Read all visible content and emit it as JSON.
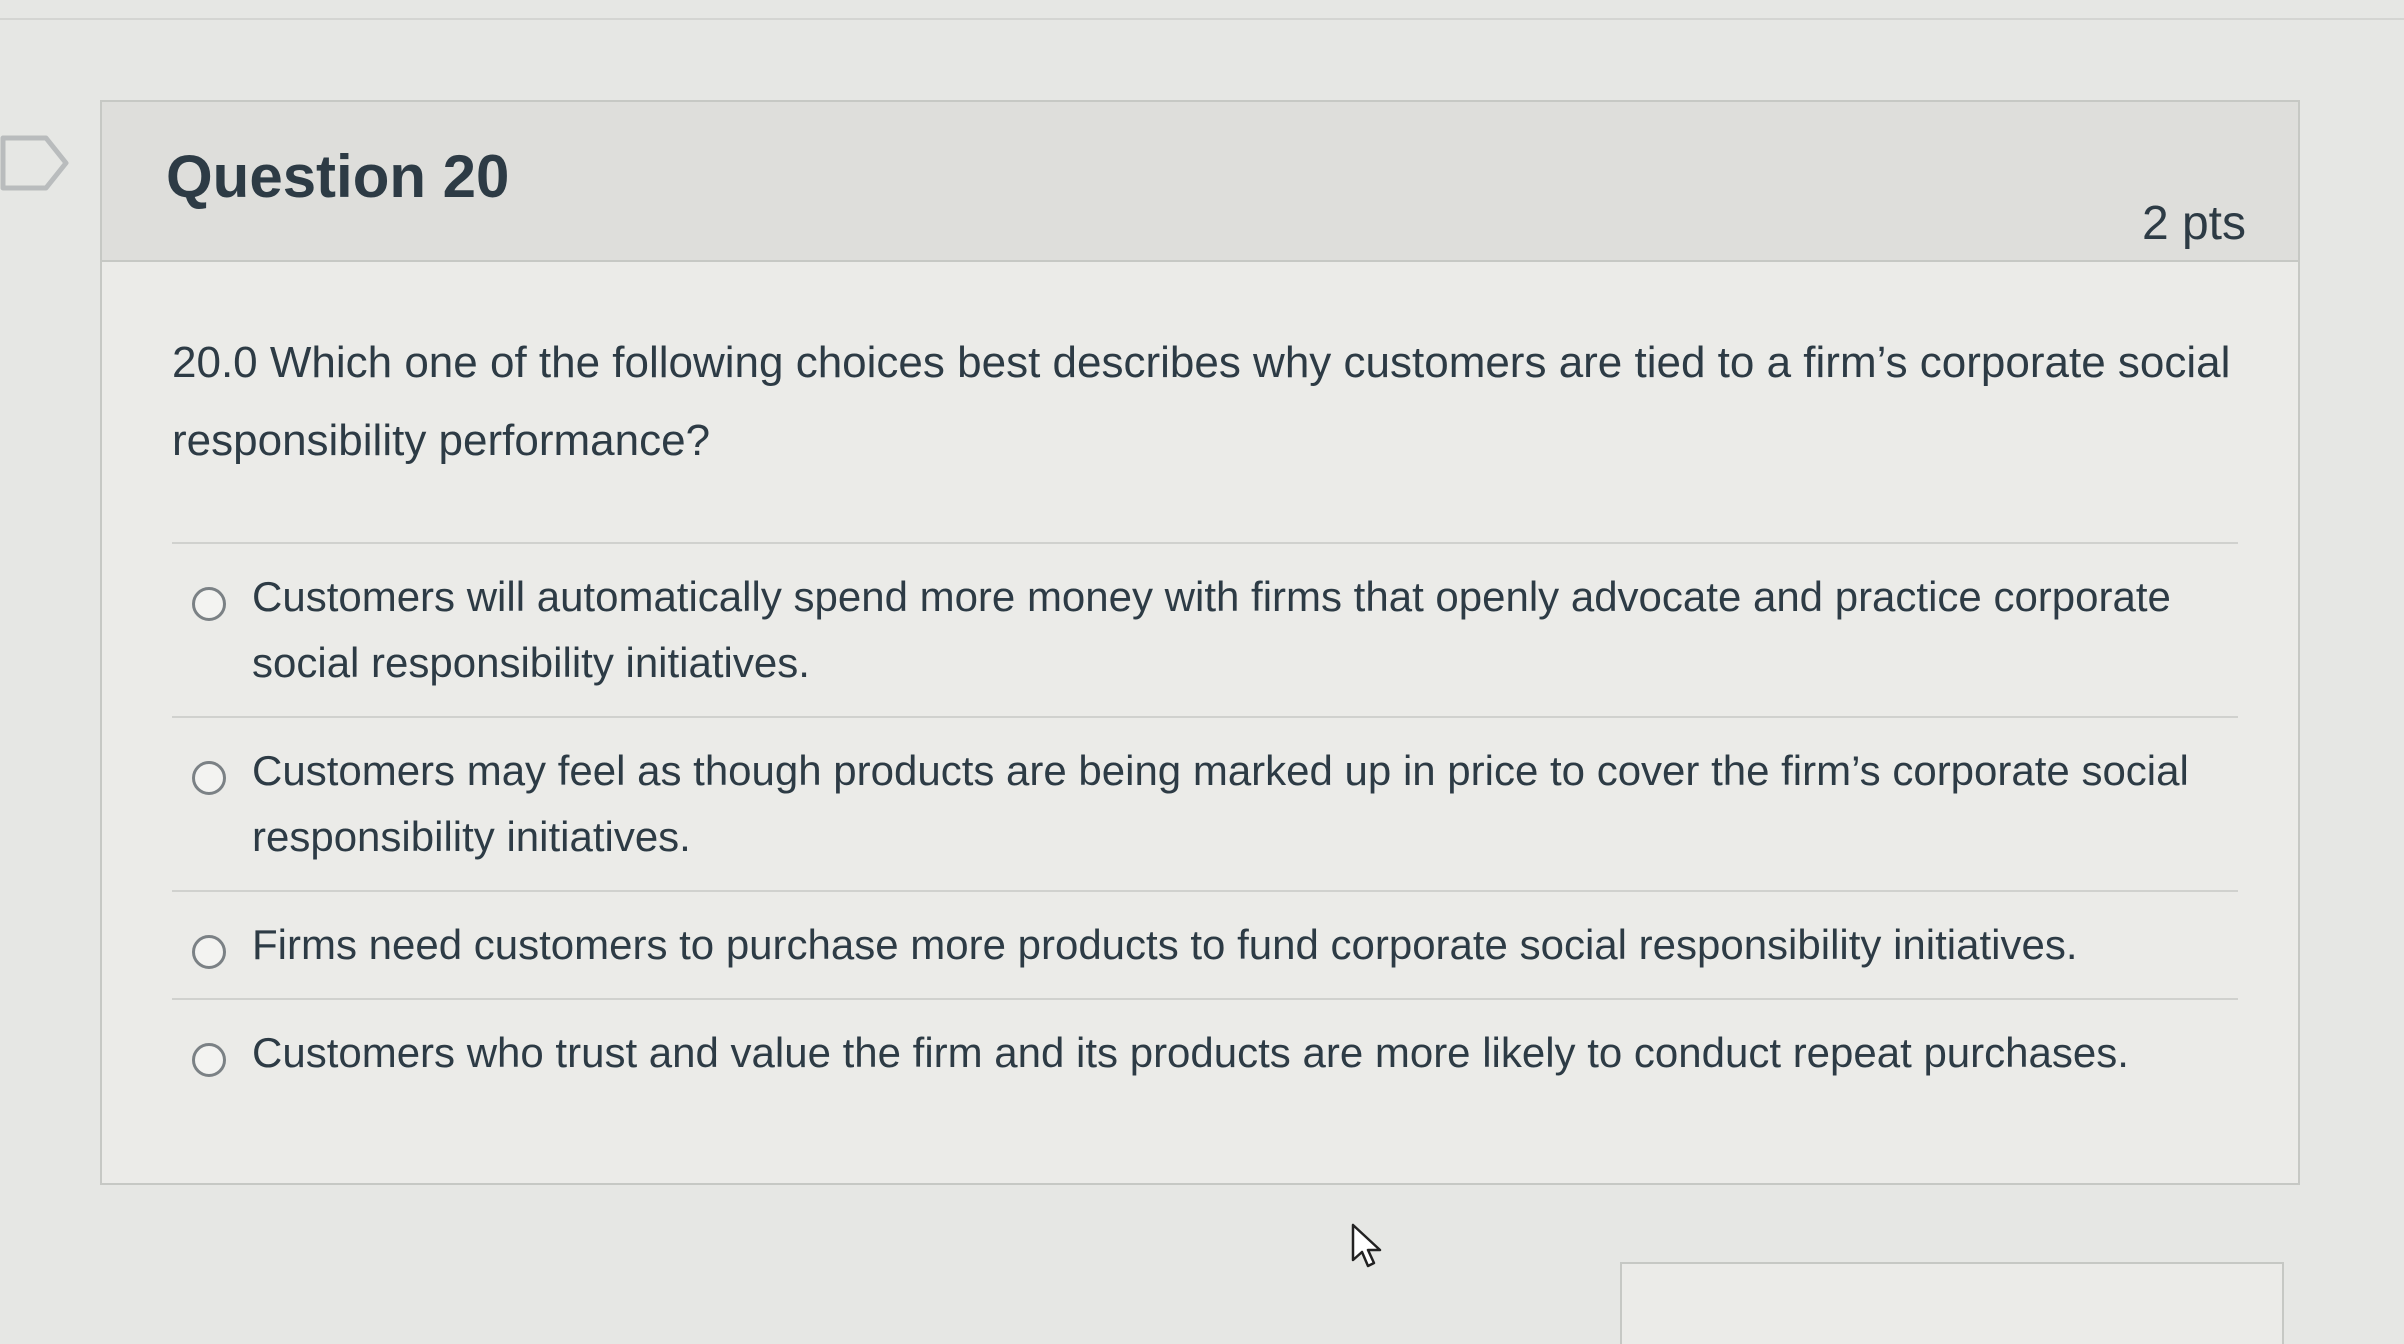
{
  "question": {
    "title": "Question 20",
    "points": "2 pts",
    "text": "20.0 Which one of the following choices best describes why customers are tied to a firm’s corporate social responsibility performance?",
    "answers": [
      {
        "label": "Customers will automatically spend more money with firms that openly advocate and practice corporate social responsibility initiatives.",
        "selected": false
      },
      {
        "label": "Customers may feel as though products are being marked up in price to cover the firm’s corporate social responsibility initiatives.",
        "selected": false
      },
      {
        "label": "Firms need customers to purchase more products to fund corporate social responsibility initiatives.",
        "selected": false
      },
      {
        "label": "Customers who trust and value the firm and its products are more likely to conduct repeat purchases.",
        "selected": false
      }
    ]
  },
  "icons": {
    "flag": "flag-question-icon",
    "cursor": "mouse-pointer-icon"
  },
  "colors": {
    "text": "#2d3b45",
    "header_bg": "#dededb",
    "body_bg": "#ebebe8",
    "border": "#c6c8c4"
  }
}
